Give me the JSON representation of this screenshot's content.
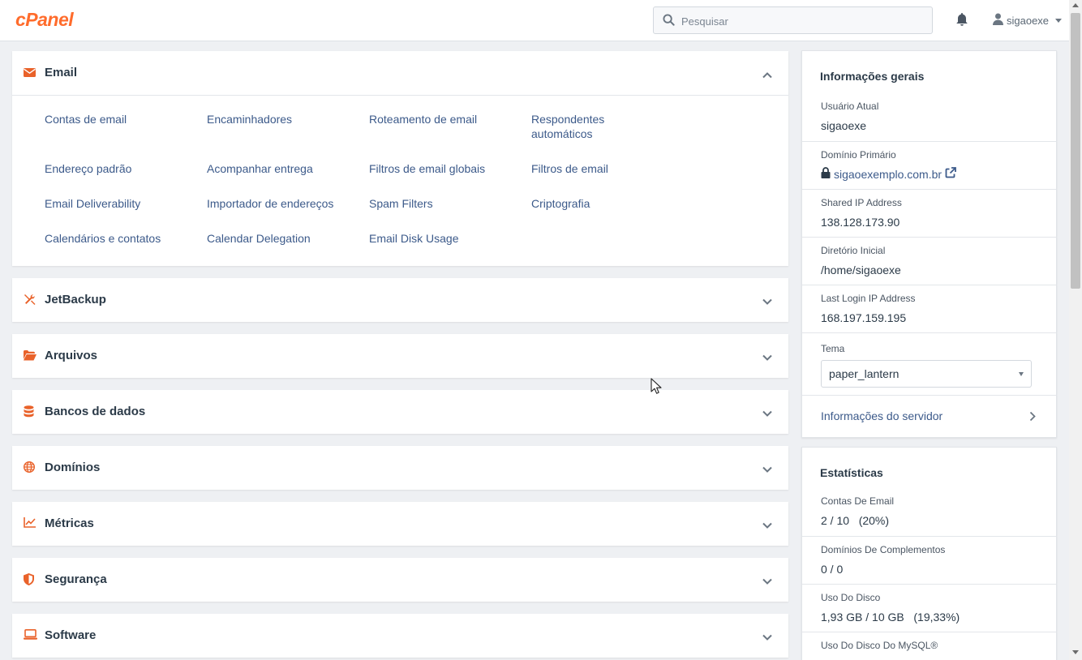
{
  "header": {
    "logo": "cPanel",
    "search_placeholder": "Pesquisar",
    "username": "sigaoexe"
  },
  "colors": {
    "accent": "#ff6c2c",
    "link": "#3c5a8a",
    "background": "#eef0f3"
  },
  "email_panel": {
    "title": "Email",
    "icon": "envelope-icon",
    "links": [
      "Contas de email",
      "Encaminhadores",
      "Roteamento de email",
      "Respondentes automáticos",
      "Endereço padrão",
      "Acompanhar entrega",
      "Filtros de email globais",
      "Filtros de email",
      "Email Deliverability",
      "Importador de endereços",
      "Spam Filters",
      "Criptografia",
      "Calendários e contatos",
      "Calendar Delegation",
      "Email Disk Usage"
    ]
  },
  "sections": [
    {
      "title": "JetBackup",
      "icon": "tools-icon"
    },
    {
      "title": "Arquivos",
      "icon": "folder-open-icon"
    },
    {
      "title": "Bancos de dados",
      "icon": "database-icon"
    },
    {
      "title": "Domínios",
      "icon": "globe-icon"
    },
    {
      "title": "Métricas",
      "icon": "chart-line-icon"
    },
    {
      "title": "Segurança",
      "icon": "shield-icon"
    },
    {
      "title": "Software",
      "icon": "laptop-icon"
    }
  ],
  "general_info": {
    "title": "Informações gerais",
    "current_user_label": "Usuário Atual",
    "current_user": "sigaoexe",
    "primary_domain_label": "Domínio Primário",
    "primary_domain": "sigaoexemplo.com.br",
    "shared_ip_label": "Shared IP Address",
    "shared_ip": "138.128.173.90",
    "home_dir_label": "Diretório Inicial",
    "home_dir": "/home/sigaoexe",
    "last_login_label": "Last Login IP Address",
    "last_login": "168.197.159.195",
    "theme_label": "Tema",
    "theme_value": "paper_lantern",
    "server_info": "Informações do servidor"
  },
  "stats": {
    "title": "Estatísticas",
    "email_accounts_label": "Contas De Email",
    "email_accounts_value": "2 / 10   (20%)",
    "addon_domains_label": "Domínios De Complementos",
    "addon_domains_value": "0 / 0",
    "disk_usage_label": "Uso Do Disco",
    "disk_usage_value": "1,93 GB / 10 GB   (19,33%)",
    "mysql_disk_label": "Uso Do Disco Do MySQL®"
  }
}
